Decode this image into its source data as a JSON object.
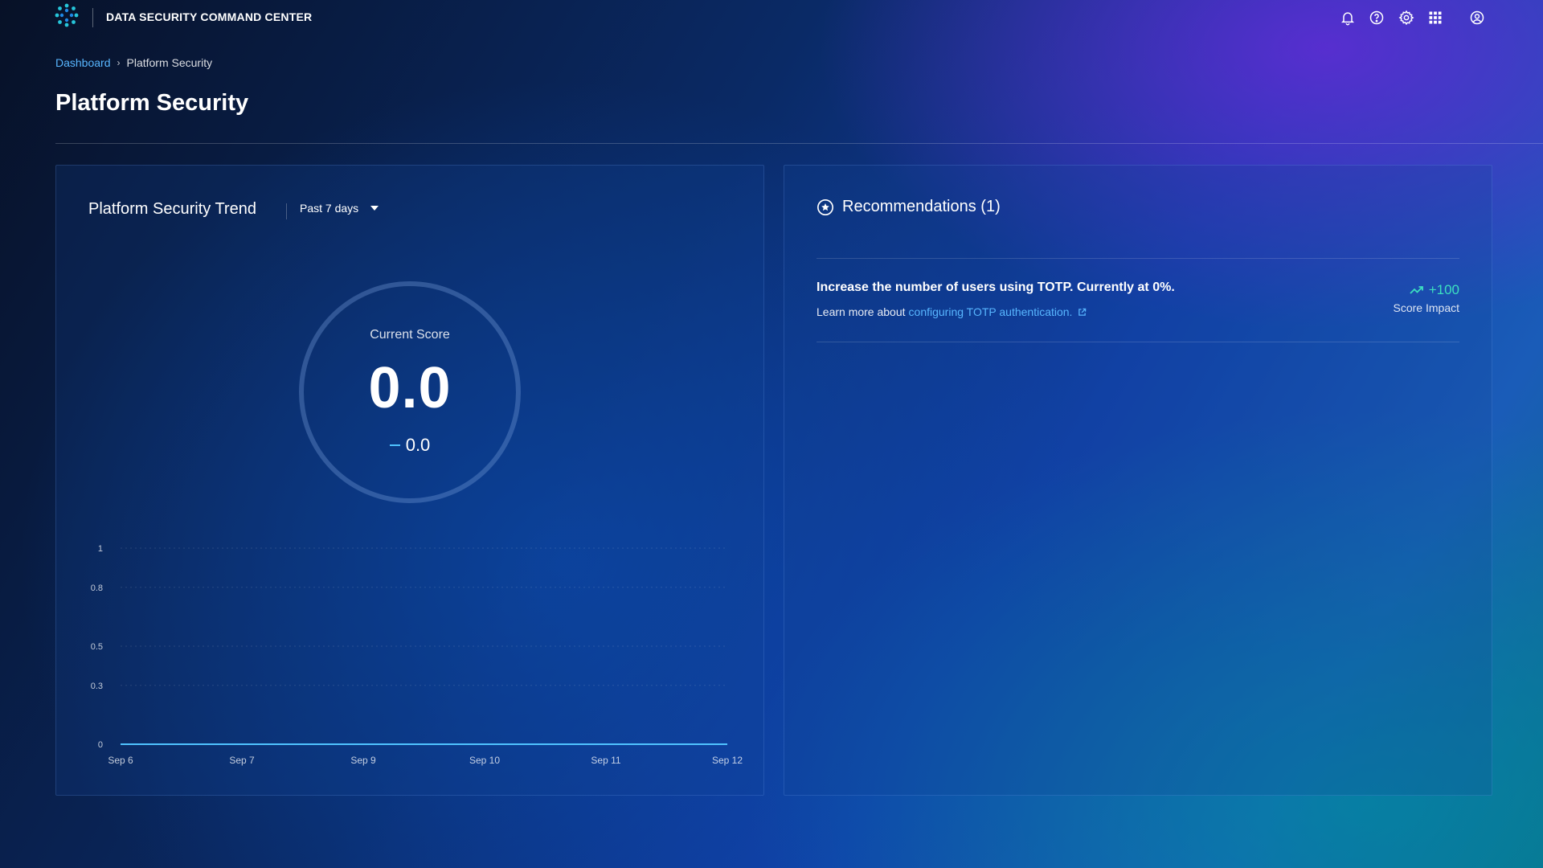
{
  "app": {
    "title": "DATA SECURITY COMMAND CENTER",
    "icons": [
      "notification-icon",
      "help-icon",
      "settings-icon",
      "apps-grid-icon",
      "user-profile-icon"
    ]
  },
  "breadcrumb": {
    "parent": "Dashboard",
    "current": "Platform Security"
  },
  "page": {
    "title": "Platform Security"
  },
  "trend": {
    "title": "Platform Security Trend",
    "range_selected": "Past 7 days",
    "score_label": "Current Score",
    "score_value": "0.0",
    "score_change": "0.0"
  },
  "recommendations": {
    "header": "Recommendations (1)",
    "items": [
      {
        "title": "Increase the number of users using TOTP. Currently at 0%.",
        "learn_more_prefix": "Learn more about",
        "link_text": "configuring TOTP authentication.",
        "impact_value": "+100",
        "impact_label": "Score Impact"
      }
    ]
  },
  "colors": {
    "accent_link": "#58b6ff",
    "impact_positive": "#3ce0c0",
    "chart_line": "#4fc3ff"
  },
  "chart_data": {
    "type": "line",
    "title": "Platform Security Trend",
    "x": [
      "Sep 6",
      "Sep 7",
      "Sep 9",
      "Sep 10",
      "Sep 11",
      "Sep 12"
    ],
    "series": [
      {
        "values": [
          0,
          0,
          0,
          0,
          0,
          0
        ]
      }
    ],
    "y_ticks": [
      "0",
      "0.3",
      "0.5",
      "0.8",
      "1"
    ],
    "ylim": [
      0,
      1
    ],
    "grid": true,
    "xlabel": "",
    "ylabel": ""
  }
}
